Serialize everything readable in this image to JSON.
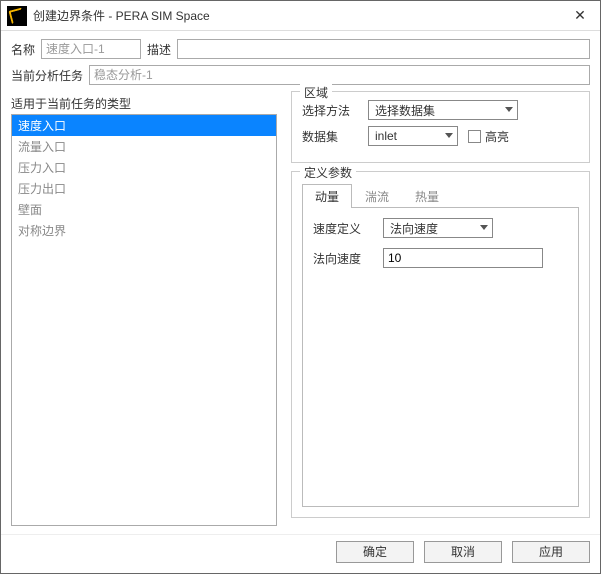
{
  "window": {
    "title": "创建边界条件 - PERA SIM Space"
  },
  "form": {
    "name_label": "名称",
    "name_value": "速度入口-1",
    "desc_label": "描述",
    "desc_value": "",
    "task_label": "当前分析任务",
    "task_value": "稳态分析-1"
  },
  "types": {
    "title": "适用于当前任务的类型",
    "items": [
      {
        "label": "速度入口",
        "selected": true
      },
      {
        "label": "流量入口",
        "selected": false
      },
      {
        "label": "压力入口",
        "selected": false
      },
      {
        "label": "压力出口",
        "selected": false
      },
      {
        "label": "壁面",
        "selected": false
      },
      {
        "label": "对称边界",
        "selected": false
      }
    ]
  },
  "region": {
    "title": "区域",
    "method_label": "选择方法",
    "method_value": "选择数据集",
    "dataset_label": "数据集",
    "dataset_value": "inlet",
    "highlight_label": "高亮",
    "highlight_checked": false
  },
  "params": {
    "title": "定义参数",
    "tabs": [
      {
        "label": "动量",
        "active": true
      },
      {
        "label": "湍流",
        "active": false
      },
      {
        "label": "热量",
        "active": false
      }
    ],
    "vel_def_label": "速度定义",
    "vel_def_value": "法向速度",
    "normal_vel_label": "法向速度",
    "normal_vel_value": "10"
  },
  "buttons": {
    "ok": "确定",
    "cancel": "取消",
    "apply": "应用"
  }
}
